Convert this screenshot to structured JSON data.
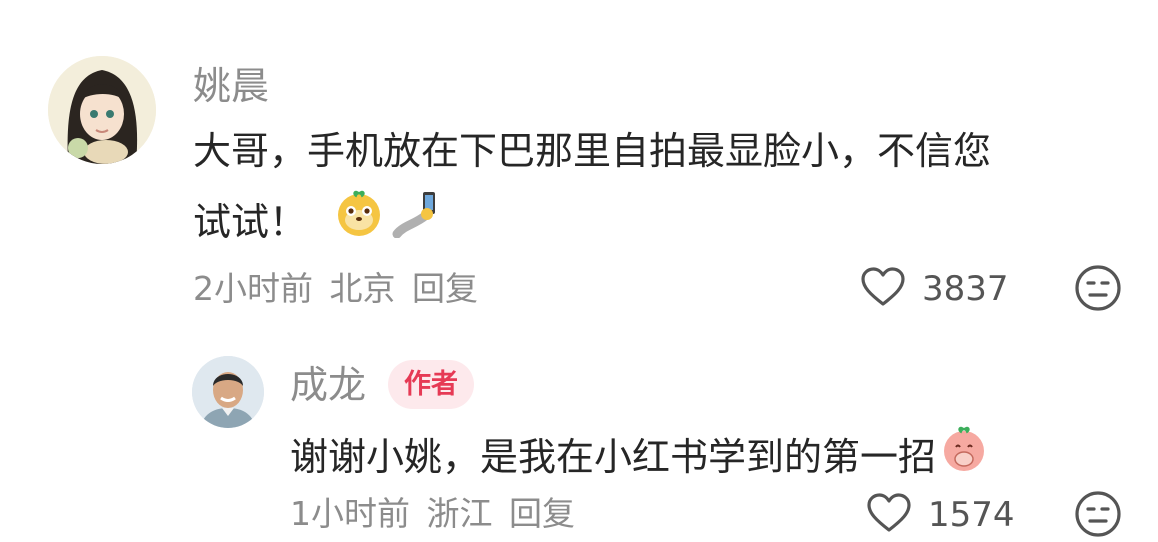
{
  "comments": [
    {
      "username": "姚晨",
      "text_line1": "大哥，手机放在下巴那里自拍最显脸小，不信您",
      "text_line2": "试试！",
      "emojis": [
        "cute-doge-emoji",
        "selfie-emoji"
      ],
      "time": "2小时前",
      "location": "北京",
      "reply_label": "回复",
      "likes": "3837",
      "dislike_icon": "meh-face-icon"
    },
    {
      "username": "成龙",
      "badge": "作者",
      "text": "谢谢小姚，是我在小红书学到的第一招",
      "emojis": [
        "covering-mouth-emoji"
      ],
      "time": "1小时前",
      "location": "浙江",
      "reply_label": "回复",
      "likes": "1574"
    }
  ]
}
